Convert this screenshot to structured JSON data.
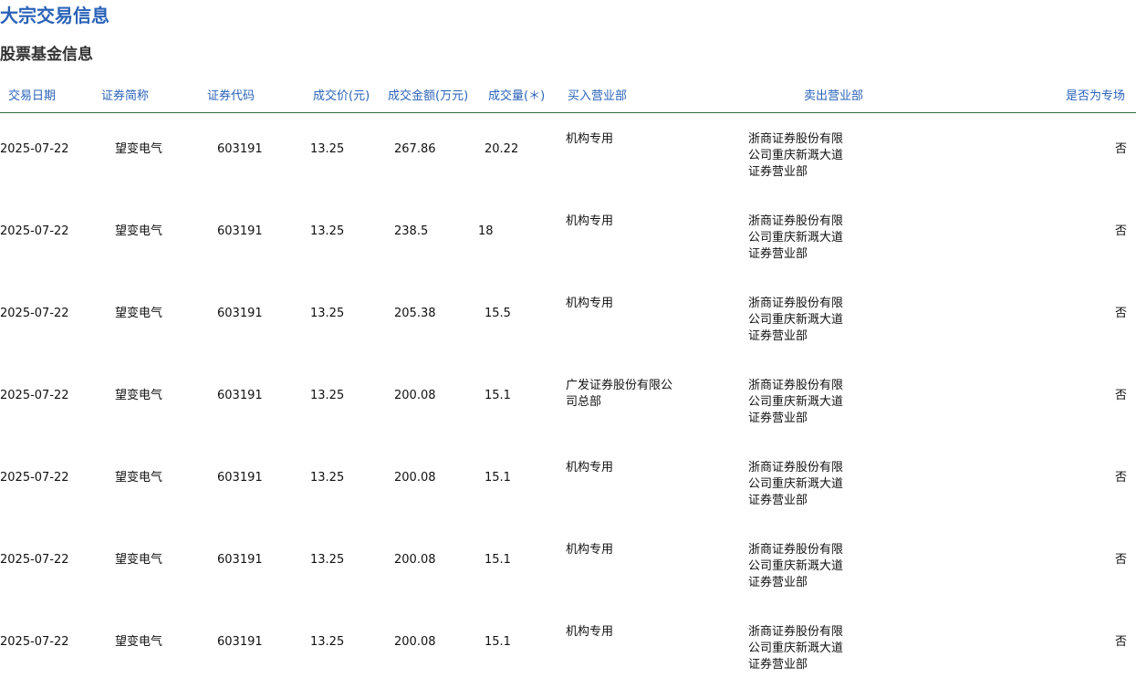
{
  "page": {
    "title": "大宗交易信息",
    "section_title": "股票基金信息"
  },
  "table": {
    "headers": {
      "date": "交易日期",
      "name": "证券简称",
      "code": "证券代码",
      "price": "成交价(元)",
      "amount": "成交金额(万元)",
      "volume": "成交量(＊)",
      "buyer": "买入营业部",
      "seller": "卖出营业部",
      "special": "是否为专场"
    },
    "rows": [
      {
        "date": "2025-07-22",
        "name": "望变电气",
        "code": "603191",
        "price": "13.25",
        "amount": "267.86",
        "volume": "20.22",
        "buyer": "机构专用",
        "seller": "浙商证券股份有限公司重庆新溉大道证券营业部",
        "special": "否"
      },
      {
        "date": "2025-07-22",
        "name": "望变电气",
        "code": "603191",
        "price": "13.25",
        "amount": "238.5",
        "volume": "18",
        "buyer": "机构专用",
        "seller": "浙商证券股份有限公司重庆新溉大道证券营业部",
        "special": "否"
      },
      {
        "date": "2025-07-22",
        "name": "望变电气",
        "code": "603191",
        "price": "13.25",
        "amount": "205.38",
        "volume": "15.5",
        "buyer": "机构专用",
        "seller": "浙商证券股份有限公司重庆新溉大道证券营业部",
        "special": "否"
      },
      {
        "date": "2025-07-22",
        "name": "望变电气",
        "code": "603191",
        "price": "13.25",
        "amount": "200.08",
        "volume": "15.1",
        "buyer": "广发证券股份有限公司总部",
        "seller": "浙商证券股份有限公司重庆新溉大道证券营业部",
        "special": "否"
      },
      {
        "date": "2025-07-22",
        "name": "望变电气",
        "code": "603191",
        "price": "13.25",
        "amount": "200.08",
        "volume": "15.1",
        "buyer": "机构专用",
        "seller": "浙商证券股份有限公司重庆新溉大道证券营业部",
        "special": "否"
      },
      {
        "date": "2025-07-22",
        "name": "望变电气",
        "code": "603191",
        "price": "13.25",
        "amount": "200.08",
        "volume": "15.1",
        "buyer": "机构专用",
        "seller": "浙商证券股份有限公司重庆新溉大道证券营业部",
        "special": "否"
      },
      {
        "date": "2025-07-22",
        "name": "望变电气",
        "code": "603191",
        "price": "13.25",
        "amount": "200.08",
        "volume": "15.1",
        "buyer": "机构专用",
        "seller": "浙商证券股份有限公司重庆新溉大道证券营业部",
        "special": "否"
      }
    ]
  }
}
